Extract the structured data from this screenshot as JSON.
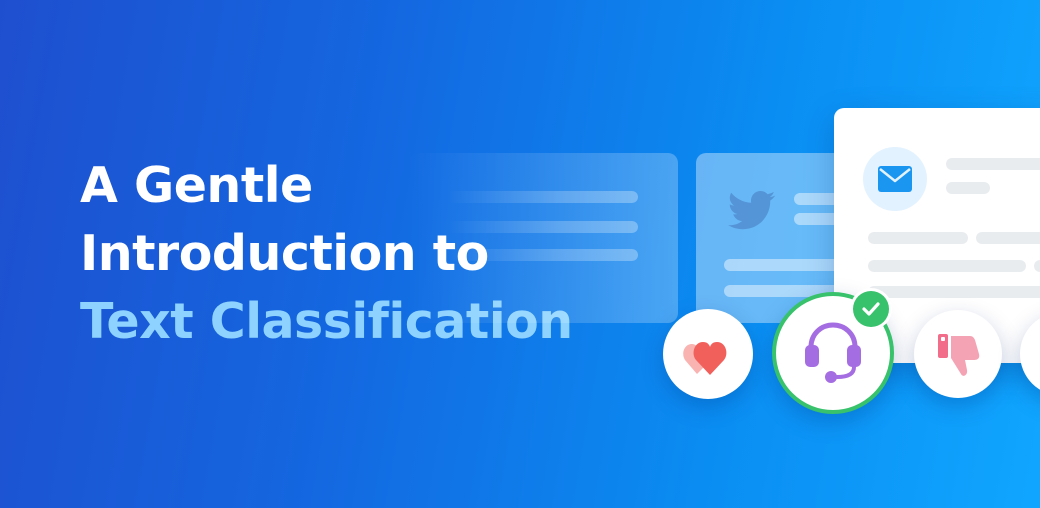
{
  "headline": {
    "line1": "A Gentle",
    "line2": "Introduction to",
    "line3": "Text Classification"
  },
  "colors": {
    "background_start": "#1e4fcf",
    "background_end": "#10a6ff",
    "accent_text": "#8ed3ff",
    "check_green": "#37c26b",
    "heart_red": "#f2605c",
    "headset_purple": "#a56de2",
    "thumbs_pink": "#f26d8a",
    "mail_blue": "#1a96f0"
  },
  "icons": {
    "tweet_card": "twitter-bird-icon",
    "email_card": "envelope-icon",
    "circle_1": "heart-icon",
    "circle_2": "headset-icon",
    "circle_2_badge": "checkmark-icon",
    "circle_3": "thumbs-down-icon"
  }
}
